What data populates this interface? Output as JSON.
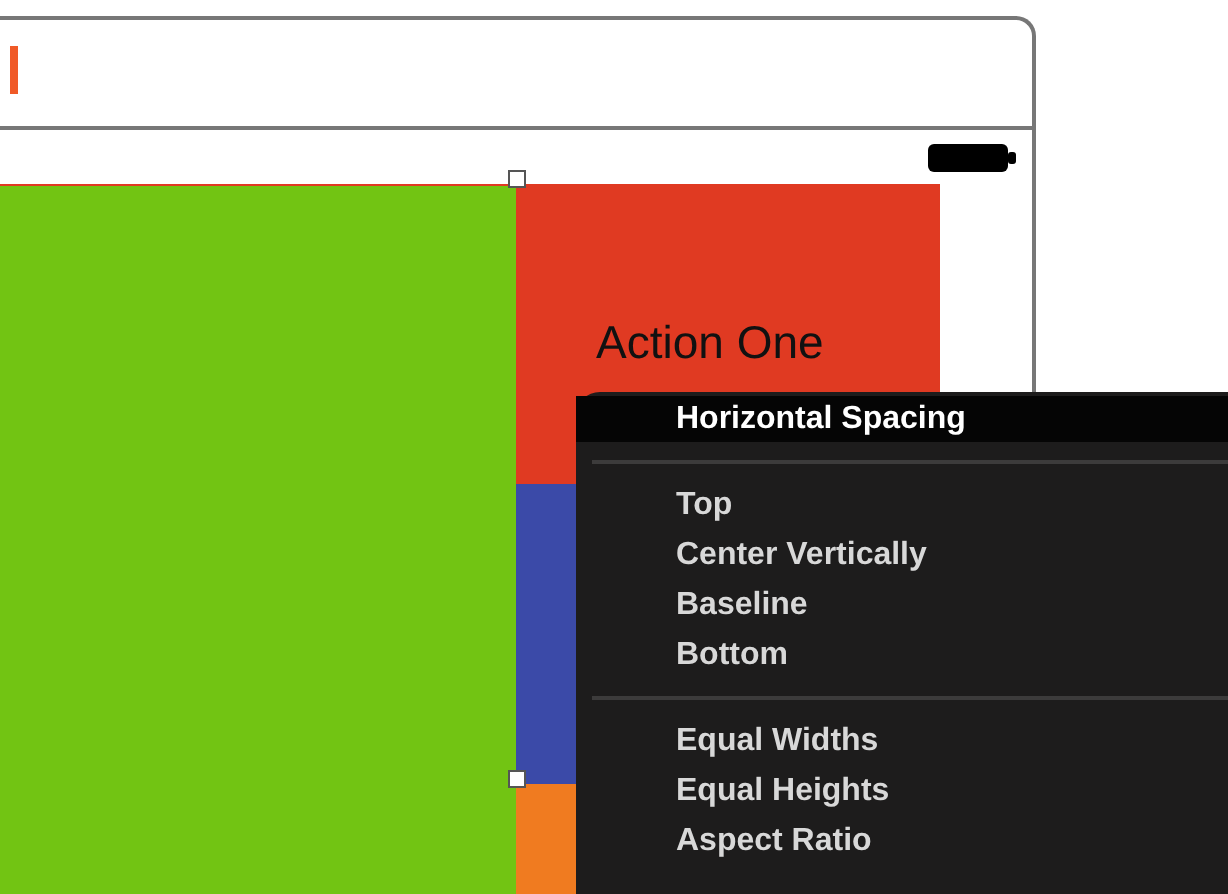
{
  "canvas": {
    "label": "Action One"
  },
  "menu": {
    "sections": [
      {
        "items": [
          {
            "label": "Horizontal Spacing",
            "selected": true
          }
        ]
      },
      {
        "items": [
          {
            "label": "Top",
            "selected": false
          },
          {
            "label": "Center Vertically",
            "selected": false
          },
          {
            "label": "Baseline",
            "selected": false
          },
          {
            "label": "Bottom",
            "selected": false
          }
        ]
      },
      {
        "items": [
          {
            "label": "Equal Widths",
            "selected": false
          },
          {
            "label": "Equal Heights",
            "selected": false
          },
          {
            "label": "Aspect Ratio",
            "selected": false
          }
        ]
      }
    ]
  }
}
